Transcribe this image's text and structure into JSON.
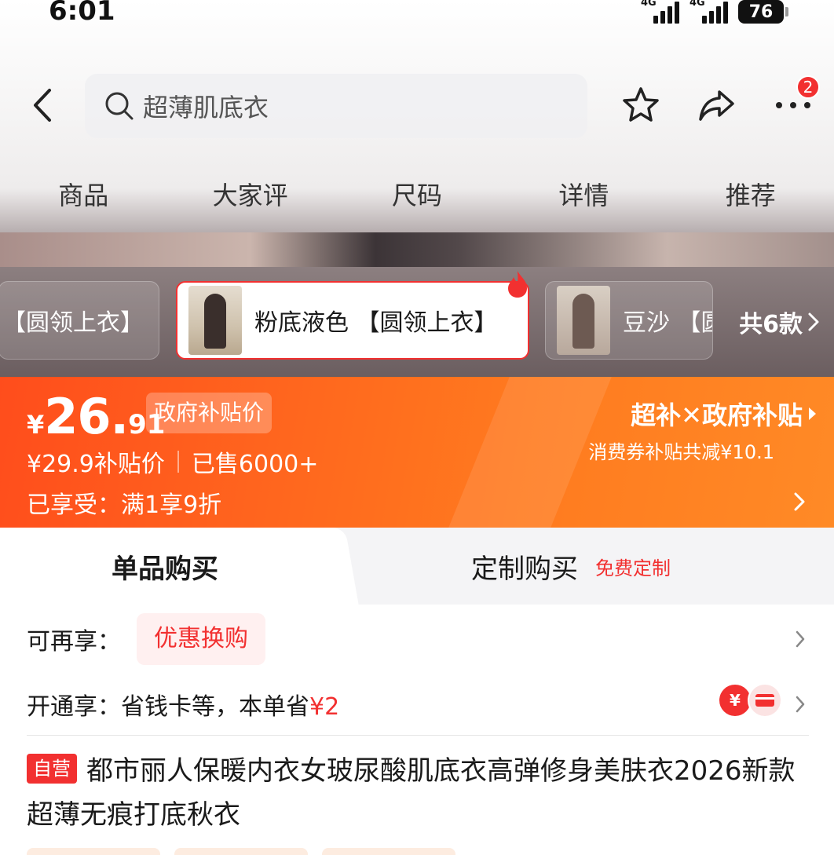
{
  "status_bar": {
    "time": "6:01",
    "net1": "4G",
    "net2": "4G",
    "battery": "76"
  },
  "nav": {
    "search_placeholder": "超薄肌底衣",
    "more_badge": "2"
  },
  "tabs": [
    "商品",
    "大家评",
    "尺码",
    "详情",
    "推荐"
  ],
  "variants": {
    "prev_label": "【圆领上衣】",
    "selected_label": "粉底液色 【圆领上衣】",
    "next_label": "豆沙 【圆",
    "total": "共6款"
  },
  "price": {
    "currency": "¥",
    "integer": "26.",
    "decimal": "91",
    "gov_tag": "政府补贴价",
    "subsidy_price": "¥29.9补贴价",
    "sold": "已售6000+",
    "enjoy": "已享受：满1享9折",
    "super_sub": "超补✕政府补贴",
    "coupon_line": "消费券补贴共减¥10.1"
  },
  "purchase_modes": {
    "single": "单品购买",
    "custom": "定制购买",
    "custom_free": "免费定制"
  },
  "benefits": {
    "row1_label": "可再享：",
    "row1_chip": "优惠换购",
    "row2_label": "开通享：省钱卡等，本单省",
    "row2_amount": "¥2"
  },
  "product": {
    "self_operated": "自营",
    "title": "都市丽人保暖内衣女玻尿酸肌底衣高弹修身美肤衣2026新款超薄无痕打底秋衣"
  },
  "colors": {
    "brand_red": "#f23030",
    "price_orange": "#ff6a1e"
  }
}
